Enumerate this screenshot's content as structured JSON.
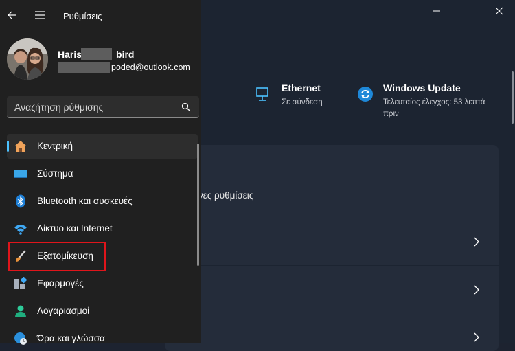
{
  "app": {
    "title": "Ρυθμίσεις"
  },
  "account": {
    "name": "Haris",
    "name_tail": "bird",
    "email": "poded@outlook.com"
  },
  "search": {
    "placeholder": "Αναζήτηση ρύθμισης"
  },
  "status": {
    "ethernet": {
      "title": "Ethernet",
      "subtitle": "Σε σύνδεση"
    },
    "update": {
      "title": "Windows Update",
      "subtitle_line1": "Τελευταίος έλεγχος: 53 λεπτά",
      "subtitle_line2": "πριν"
    }
  },
  "main": {
    "partial_text": "νες ρυθμίσεις"
  },
  "nav": {
    "items": [
      {
        "label": "Κεντρική",
        "icon": "home-icon"
      },
      {
        "label": "Σύστημα",
        "icon": "system-icon"
      },
      {
        "label": "Bluetooth και συσκευές",
        "icon": "bluetooth-icon"
      },
      {
        "label": "Δίκτυο και Internet",
        "icon": "wifi-icon"
      },
      {
        "label": "Εξατομίκευση",
        "icon": "brush-icon"
      },
      {
        "label": "Εφαρμογές",
        "icon": "apps-icon"
      },
      {
        "label": "Λογαριασμοί",
        "icon": "account-icon"
      },
      {
        "label": "Ώρα και γλώσσα",
        "icon": "globe-clock-icon"
      }
    ],
    "active_index": 0,
    "highlighted_index": 4
  },
  "colors": {
    "accent": "#4cc2ff",
    "highlight_border": "#e0151b",
    "panel_bg": "#202020",
    "main_bg": "#1c2431"
  }
}
